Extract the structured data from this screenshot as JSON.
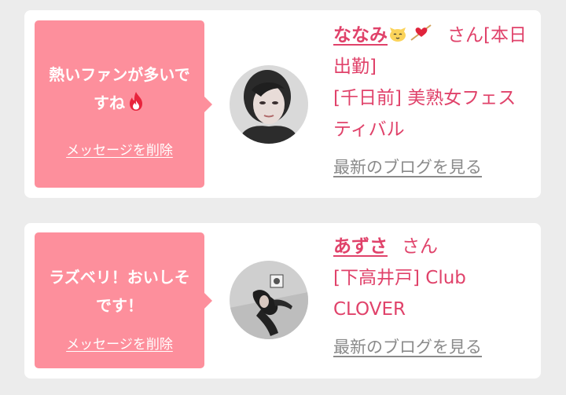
{
  "cards": [
    {
      "message": "熱いファンが多いですね",
      "message_icon": "fire-icon",
      "delete_label": "メッセージを削除",
      "name": "ななみ",
      "name_icons": [
        "cat-face-icon",
        "heart-arrow-icon"
      ],
      "honorific": "さん",
      "status": "[本日出勤]",
      "shop": "[千日前] 美熟女フェスティバル",
      "blog_label": "最新のブログを見る"
    },
    {
      "message": "ラズベリ！おいしそです！",
      "delete_label": "メッセージを削除",
      "name": "あずさ",
      "honorific": "さん",
      "shop": "[下高井戸] Club CLOVER",
      "blog_label": "最新のブログを見る"
    }
  ],
  "colors": {
    "bubble": "#fd8f9c",
    "accent": "#e0426a",
    "link_gray": "#8a8a8a",
    "background": "#ececec"
  }
}
